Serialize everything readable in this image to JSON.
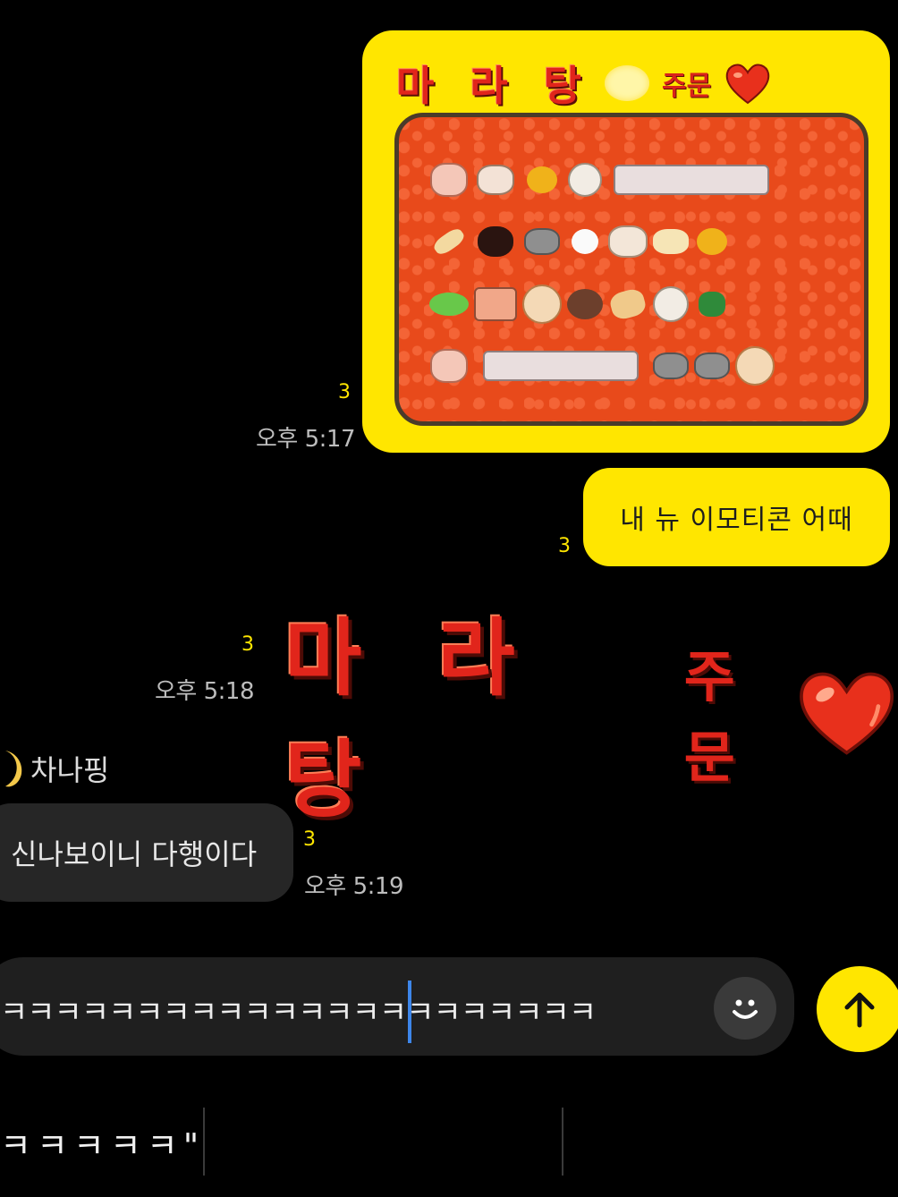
{
  "messages": {
    "emoticon_card": {
      "title_syllables": "마 라 탕",
      "title_order": "주문",
      "unread": "3",
      "time": "오후 5:17"
    },
    "sent_text": {
      "text": "내 뉴 이모티콘 어때",
      "unread": "3"
    },
    "big_emoticon": {
      "syllables": "마 라 탕",
      "order": "주문",
      "unread": "3",
      "time": "오후 5:18"
    },
    "received": {
      "sender": "차나핑",
      "text": "신나보이니 다행이다",
      "unread": "3",
      "time": "오후 5:19"
    }
  },
  "composer": {
    "input_value": "ㅋㅋㅋㅋㅋㅋㅋㅋㅋㅋㅋㅋㅋㅋㅋㅋㅋㅋㅋㅋㅋㅋ",
    "emoji_icon": "smiley-icon",
    "send_icon": "arrow-up-icon"
  },
  "suggestions": {
    "first": "ㅋㅋㅋㅋㅋ\""
  },
  "colors": {
    "accent": "#ffe600",
    "background": "#000000",
    "received_bubble": "#262626",
    "emoticon_red": "#e1251b"
  }
}
